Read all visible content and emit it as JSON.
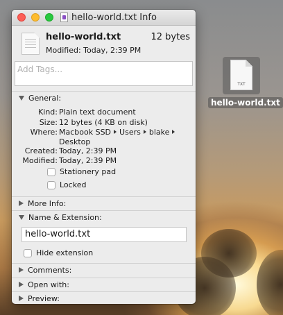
{
  "desktop": {
    "icon": {
      "badge": "TXT",
      "label": "hello-world.txt"
    }
  },
  "window": {
    "title": "hello-world.txt Info",
    "header": {
      "file_name": "hello-world.txt",
      "size": "12 bytes",
      "modified": "Modified: Today, 2:39 PM"
    },
    "tags_placeholder": "Add Tags...",
    "general": {
      "label": "General:",
      "rows": {
        "kind": {
          "key": "Kind:",
          "value": "Plain text document"
        },
        "size": {
          "key": "Size:",
          "value": "12 bytes (4 KB on disk)"
        },
        "where": {
          "key": "Where:",
          "path": [
            "Macbook SSD",
            "Users",
            "blake"
          ],
          "path_last": "Desktop"
        },
        "created": {
          "key": "Created:",
          "value": "Today, 2:39 PM"
        },
        "modified": {
          "key": "Modified:",
          "value": "Today, 2:39 PM"
        }
      },
      "stationery_label": "Stationery pad",
      "locked_label": "Locked"
    },
    "more_info_label": "More Info:",
    "name_extension": {
      "label": "Name & Extension:",
      "name_value": "hello-world.txt",
      "hide_extension_label": "Hide extension"
    },
    "comments_label": "Comments:",
    "open_with_label": "Open with:",
    "preview_label": "Preview:"
  },
  "colors": {
    "close": "#fd5f57",
    "minimize": "#febc2e",
    "zoom": "#28c840",
    "window_bg": "#ececec"
  }
}
